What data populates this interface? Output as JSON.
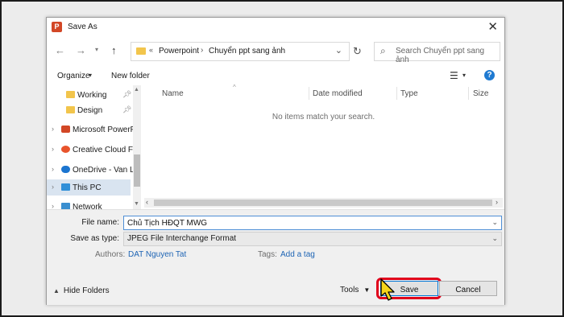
{
  "window": {
    "title": "Save As",
    "app_icon": "P",
    "accent": "#d24726"
  },
  "address": {
    "overflow": "«",
    "crumbs": [
      "Powerpoint",
      "Chuyển ppt sang ảnh"
    ],
    "separator": "›"
  },
  "search": {
    "placeholder": "Search Chuyển ppt sang ảnh"
  },
  "toolbar": {
    "organize_label": "Organize",
    "new_folder_label": "New folder"
  },
  "nav": {
    "items": [
      {
        "label": "Working"
      },
      {
        "label": "Design"
      },
      {
        "label": "Microsoft PowerPo"
      },
      {
        "label": "Creative Cloud File"
      },
      {
        "label": "OneDrive - Van La"
      },
      {
        "label": "This PC"
      },
      {
        "label": "Network"
      }
    ]
  },
  "columns": {
    "name": "Name",
    "date_modified": "Date modified",
    "type": "Type",
    "size": "Size"
  },
  "file_list": {
    "empty_message": "No items match your search."
  },
  "form": {
    "file_name_label": "File name:",
    "file_name_value": "Chủ Tịch HĐQT MWG",
    "save_as_type_label": "Save as type:",
    "save_as_type_value": "JPEG File Interchange Format",
    "authors_label": "Authors:",
    "authors_value": "DAT Nguyen Tat",
    "tags_label": "Tags:",
    "tags_value": "Add a tag"
  },
  "footer": {
    "hide_folders_label": "Hide Folders",
    "tools_label": "Tools",
    "save_label": "Save",
    "cancel_label": "Cancel"
  },
  "colors": {
    "link": "#1e64b4",
    "highlight_ring": "#e0001b",
    "selection": "#d9e4f0",
    "cursor_fill": "#f5d51b"
  }
}
